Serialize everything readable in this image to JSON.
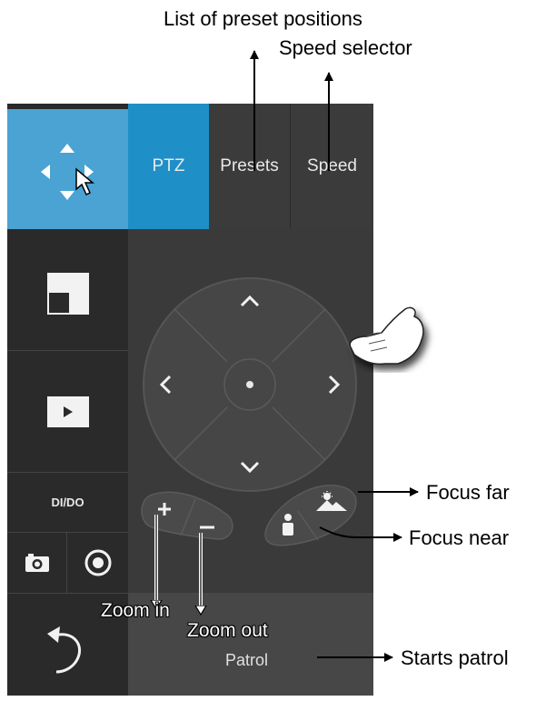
{
  "tabs": {
    "ptz": "PTZ",
    "presets": "Presets",
    "speed": "Speed"
  },
  "sidebar": {
    "dido": "DI/DO"
  },
  "patrol": {
    "label": "Patrol"
  },
  "annotations": {
    "presets": "List of preset positions",
    "speed": "Speed selector",
    "focus_far": "Focus far",
    "focus_near": "Focus near",
    "zoom_in": "Zoom in",
    "zoom_out": "Zoom out",
    "patrol": "Starts patrol"
  },
  "colors": {
    "accent": "#1f8fc8",
    "nav_active": "#4aa3d3",
    "panel": "#2b2b2b",
    "main": "#3a3a3a"
  },
  "icons": [
    "move-arrows-icon",
    "cursor-icon",
    "layout-icon",
    "play-icon",
    "camera-icon",
    "record-icon",
    "back-arrow-icon",
    "hand-pointer-icon",
    "person-icon",
    "mountain-icon"
  ]
}
